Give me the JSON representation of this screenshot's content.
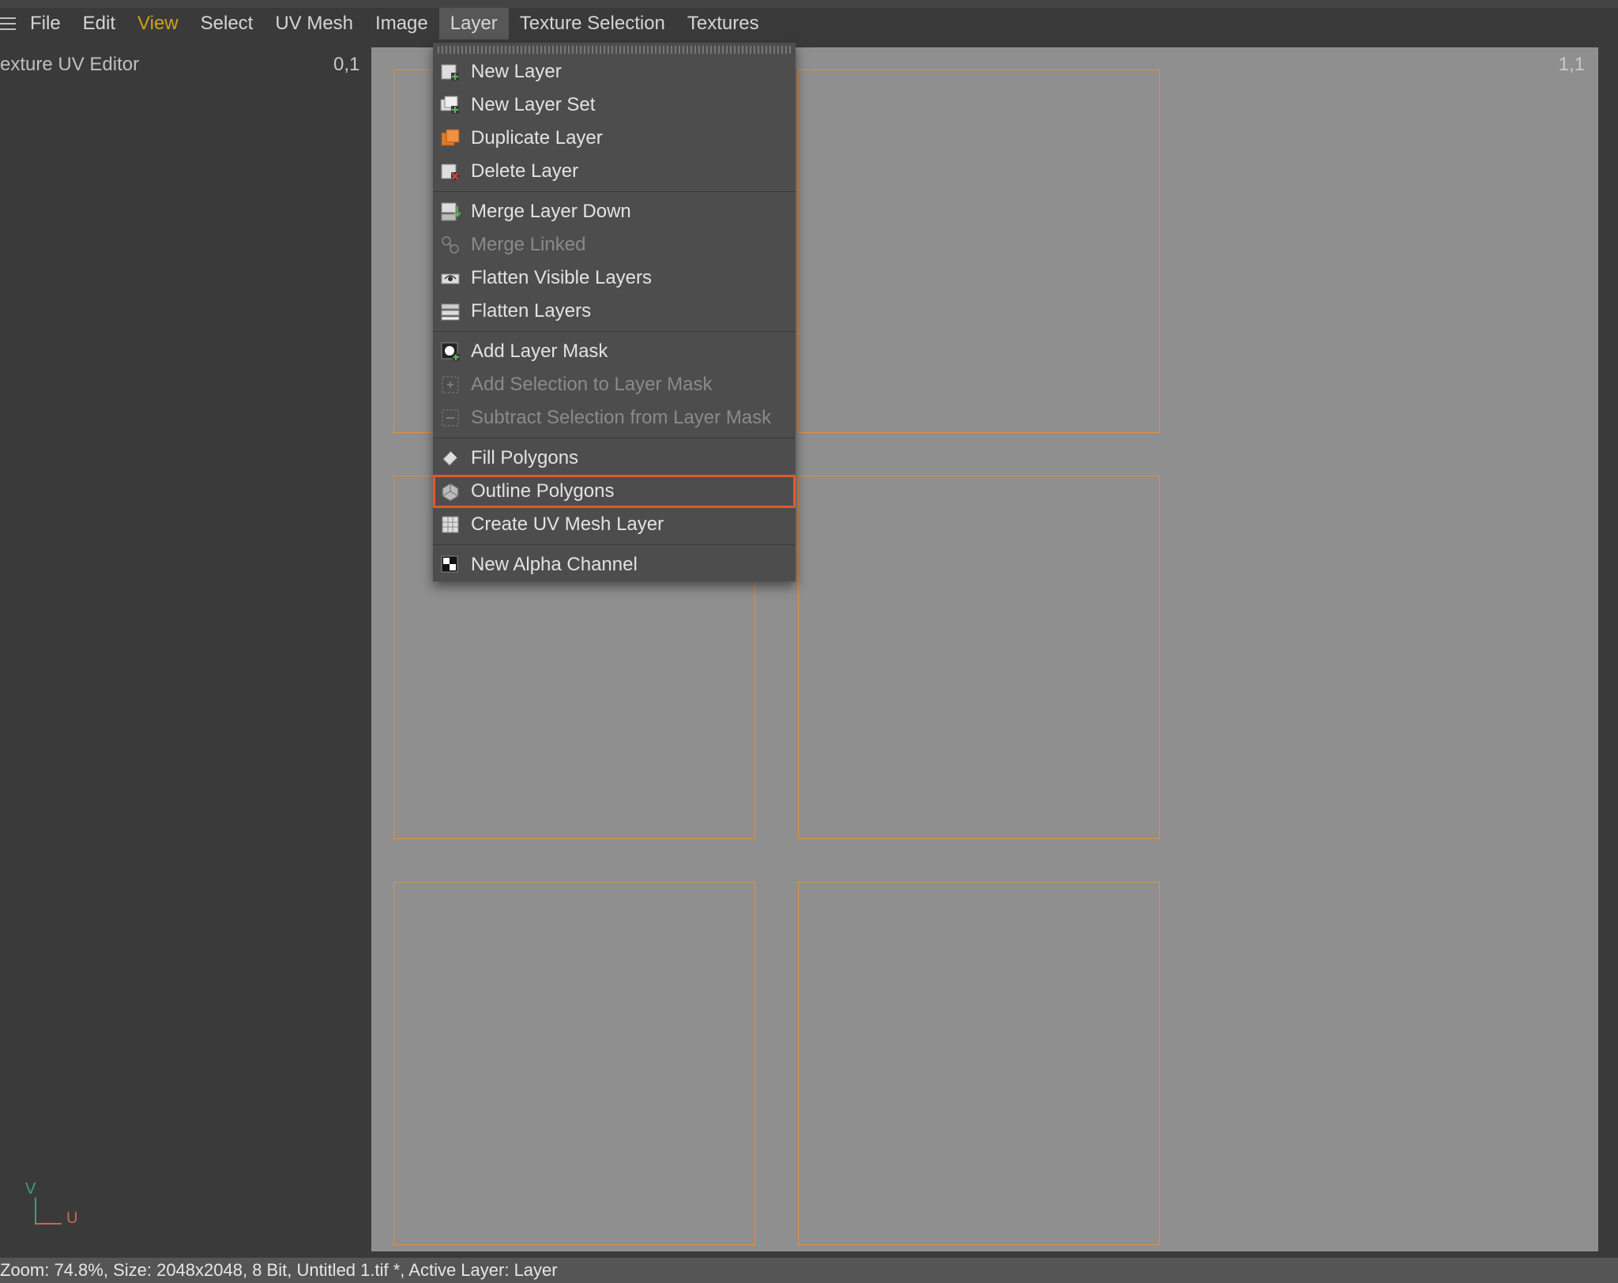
{
  "menubar": {
    "items": [
      "File",
      "Edit",
      "View",
      "Select",
      "UV Mesh",
      "Image",
      "Layer",
      "Texture Selection",
      "Textures"
    ],
    "open_index": 6,
    "accent_index": 2
  },
  "panel": {
    "title": "exture UV Editor"
  },
  "coords": {
    "top_left": "0,1",
    "top_right": "1,1"
  },
  "axis": {
    "v": "V",
    "u": "U"
  },
  "status": {
    "text": "Zoom: 74.8%, Size: 2048x2048, 8 Bit, Untitled 1.tif *, Active Layer: Layer"
  },
  "layer_menu": {
    "groups": [
      [
        {
          "icon": "new-layer-icon",
          "label": "New Layer",
          "enabled": true
        },
        {
          "icon": "new-layer-set-icon",
          "label": "New Layer Set",
          "enabled": true
        },
        {
          "icon": "duplicate-layer-icon",
          "label": "Duplicate Layer",
          "enabled": true
        },
        {
          "icon": "delete-layer-icon",
          "label": "Delete Layer",
          "enabled": true
        }
      ],
      [
        {
          "icon": "merge-down-icon",
          "label": "Merge Layer Down",
          "enabled": true
        },
        {
          "icon": "merge-linked-icon",
          "label": "Merge Linked",
          "enabled": false
        },
        {
          "icon": "flatten-visible-icon",
          "label": "Flatten Visible Layers",
          "enabled": true
        },
        {
          "icon": "flatten-layers-icon",
          "label": "Flatten Layers",
          "enabled": true
        }
      ],
      [
        {
          "icon": "add-mask-icon",
          "label": "Add Layer Mask",
          "enabled": true
        },
        {
          "icon": "add-sel-mask-icon",
          "label": "Add Selection to Layer Mask",
          "enabled": false
        },
        {
          "icon": "sub-sel-mask-icon",
          "label": "Subtract Selection from Layer Mask",
          "enabled": false
        }
      ],
      [
        {
          "icon": "fill-polygons-icon",
          "label": "Fill Polygons",
          "enabled": true
        },
        {
          "icon": "outline-polygons-icon",
          "label": "Outline Polygons",
          "enabled": true,
          "highlight": true
        },
        {
          "icon": "uv-mesh-layer-icon",
          "label": "Create UV Mesh Layer",
          "enabled": true
        }
      ],
      [
        {
          "icon": "new-alpha-icon",
          "label": "New Alpha Channel",
          "enabled": true
        }
      ]
    ]
  },
  "colors": {
    "uv_outline": "#e09040",
    "highlight": "#e4562a"
  }
}
